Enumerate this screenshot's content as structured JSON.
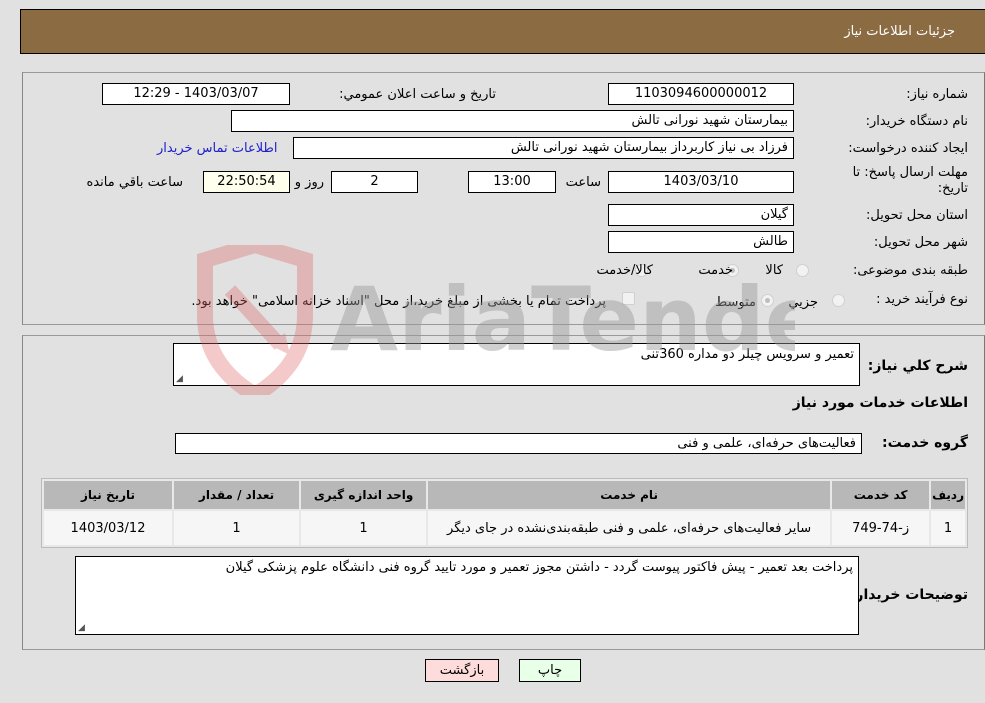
{
  "header": {
    "title": "جزئیات اطلاعات نیاز"
  },
  "details": {
    "need_number_label": "شماره نیاز:",
    "need_number": "1103094600000012",
    "announce_label": "تاریخ و ساعت اعلان عمومي:",
    "announce_value": "1403/03/07 - 12:29",
    "buyer_org_label": "نام دستگاه خریدار:",
    "buyer_org": "بیمارستان شهید نورانی تالش",
    "creator_label": "ایجاد کننده درخواست:",
    "creator": "فرزاد بی نیاز کاربرداز بیمارستان شهید نورانی تالش",
    "contact_link": "اطلاعات تماس خریدار",
    "deadline_label_line1": "مهلت ارسال پاسخ: تا",
    "deadline_label_line2": "تاریخ:",
    "deadline_date": "1403/03/10",
    "time_label": "ساعت",
    "deadline_time": "13:00",
    "days_value": "2",
    "days_label": "روز و",
    "remaining_time": "22:50:54",
    "remaining_label": "ساعت باقي مانده",
    "province_label": "استان محل تحویل:",
    "province": "گیلان",
    "city_label": "شهر محل تحویل:",
    "city": "طالش",
    "category_label": "طبقه بندی موضوعی:",
    "category_options": [
      {
        "label": "کالا",
        "checked": false
      },
      {
        "label": "خدمت",
        "checked": true
      },
      {
        "label": "کالا/خدمت",
        "checked": false
      }
    ],
    "process_label": "نوع فرآیند خرید :",
    "process_options": [
      {
        "label": "جزيي",
        "checked": false
      },
      {
        "label": "متوسط",
        "checked": true
      }
    ],
    "treasury_note": "پرداخت تمام یا بخشی از مبلغ خرید،از محل \"اسناد خزانه اسلامی\" خواهد بود."
  },
  "description": {
    "label": "شرح کلي نیاز:",
    "value": "تعمیر و سرویس چیلر دو مداره 360تنی"
  },
  "services": {
    "section_title": "اطلاعات خدمات مورد نیاز",
    "group_label": "گروه خدمت:",
    "group_value": "فعالیت‌های حرفه‌ای، علمی و فنی",
    "table": {
      "headers": [
        "ردیف",
        "کد خدمت",
        "نام خدمت",
        "واحد اندازه گیری",
        "تعداد / مقدار",
        "تاریخ نیاز"
      ],
      "rows": [
        [
          "1",
          "ز-74-749",
          "سایر فعالیت‌های حرفه‌ای، علمی و فنی طبقه‌بندی‌نشده در جای دیگر",
          "1",
          "1",
          "1403/03/12"
        ]
      ]
    }
  },
  "buyer_notes": {
    "label": "توضیحات خریدار:",
    "value": "پرداخت بعد تعمیر - پیش فاکتور پیوست گردد - داشتن مجوز تعمیر و مورد تایید گروه فنی دانشگاه علوم پزشکی گیلان"
  },
  "buttons": {
    "print": "چاپ",
    "back": "بازگشت"
  },
  "watermark": {
    "text": "AriaTender.neT"
  }
}
